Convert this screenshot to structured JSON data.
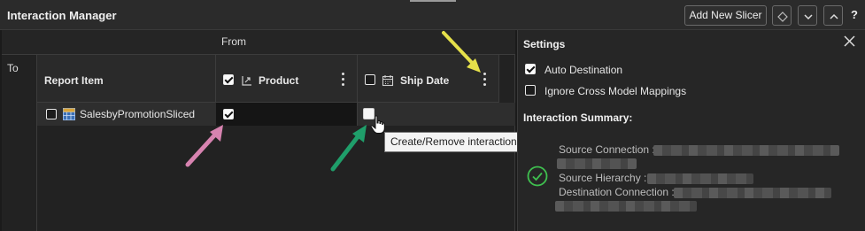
{
  "header": {
    "title": "Interaction Manager",
    "add_slicer_label": "Add New Slicer",
    "help_label": "?"
  },
  "grid": {
    "from_label": "From",
    "to_label": "To",
    "columns": [
      {
        "label": "Report Item"
      },
      {
        "label": "Product",
        "checked": true
      },
      {
        "label": "Ship Date",
        "checked": false
      }
    ],
    "rows": [
      {
        "label": "SalesbyPromotionSliced",
        "checked": false,
        "product": true,
        "ship_date": false
      }
    ]
  },
  "tooltip": {
    "text": "Create/Remove interaction"
  },
  "settings": {
    "title": "Settings",
    "options": [
      {
        "label": "Auto Destination",
        "checked": true
      },
      {
        "label": "Ignore Cross Model Mappings",
        "checked": false
      }
    ],
    "summary_title": "Interaction Summary:",
    "summary": {
      "source_connection_label": "Source Connection :",
      "source_hierarchy_label": "Source Hierarchy :",
      "destination_connection_label": "Destination Connection :"
    }
  },
  "colors": {
    "annotation_yellow": "#e5e04a",
    "annotation_pink": "#d783b0",
    "annotation_green": "#1f9e6a",
    "status_ok": "#3fbf4f"
  }
}
